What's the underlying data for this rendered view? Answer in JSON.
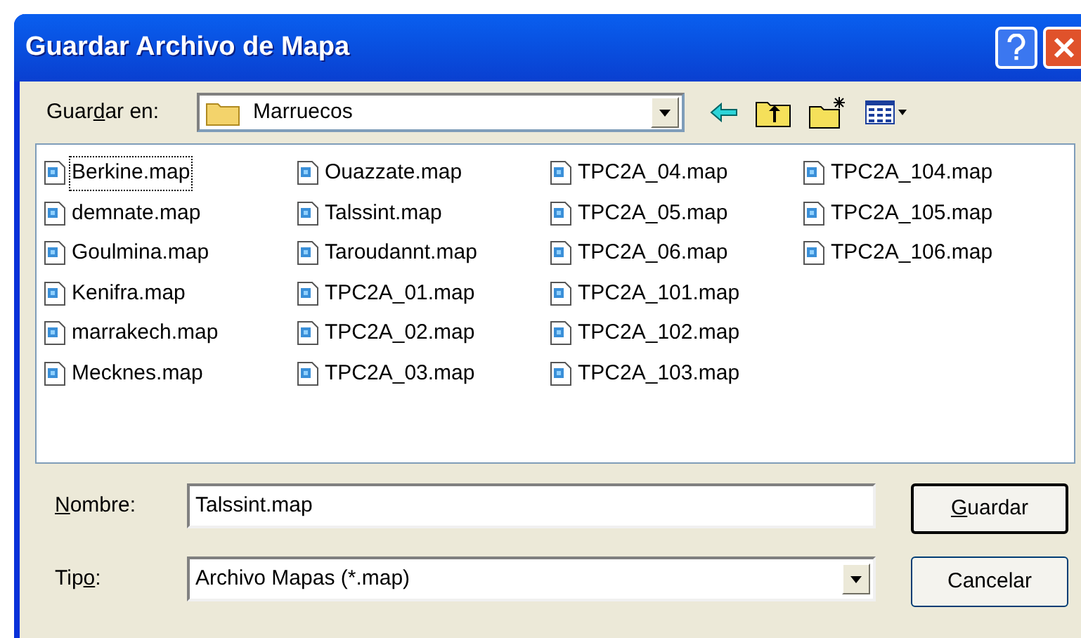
{
  "window": {
    "title": "Guardar Archivo de Mapa"
  },
  "save_in": {
    "label": {
      "before": "Guar",
      "key": "d",
      "after": "ar en:"
    },
    "value": "Marruecos"
  },
  "files": [
    {
      "name": "Berkine.map",
      "focused": true
    },
    {
      "name": "demnate.map",
      "focused": false
    },
    {
      "name": "Goulmina.map",
      "focused": false
    },
    {
      "name": "Kenifra.map",
      "focused": false
    },
    {
      "name": "marrakech.map",
      "focused": false
    },
    {
      "name": "Mecknes.map",
      "focused": false
    },
    {
      "name": "Ouazzate.map",
      "focused": false
    },
    {
      "name": "Talssint.map",
      "focused": false
    },
    {
      "name": "Taroudannt.map",
      "focused": false
    },
    {
      "name": "TPC2A_01.map",
      "focused": false
    },
    {
      "name": "TPC2A_02.map",
      "focused": false
    },
    {
      "name": "TPC2A_03.map",
      "focused": false
    },
    {
      "name": "TPC2A_04.map",
      "focused": false
    },
    {
      "name": "TPC2A_05.map",
      "focused": false
    },
    {
      "name": "TPC2A_06.map",
      "focused": false
    },
    {
      "name": "TPC2A_101.map",
      "focused": false
    },
    {
      "name": "TPC2A_102.map",
      "focused": false
    },
    {
      "name": "TPC2A_103.map",
      "focused": false
    },
    {
      "name": "TPC2A_104.map",
      "focused": false
    },
    {
      "name": "TPC2A_105.map",
      "focused": false
    },
    {
      "name": "TPC2A_106.map",
      "focused": false
    }
  ],
  "name_field": {
    "label": {
      "key": "N",
      "after": "ombre:"
    },
    "value": "Talssint.map"
  },
  "type_field": {
    "label": {
      "before": "Tip",
      "key": "o",
      "after": ":"
    },
    "value": "Archivo Mapas (*.map)"
  },
  "buttons": [
    {
      "label": {
        "key": "G",
        "after": "uardar"
      },
      "default": true
    },
    {
      "label": {
        "before": "Cancelar"
      },
      "default": false
    }
  ]
}
